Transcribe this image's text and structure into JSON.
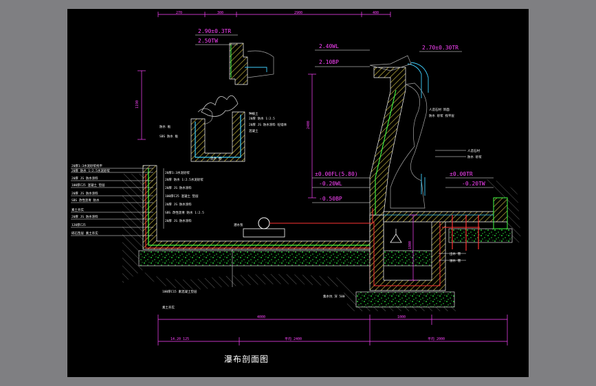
{
  "title": "瀑布剖面图",
  "elevations": {
    "top_left_tr": "2.90±0.3TR",
    "top_left_tw": "2.50TW",
    "mid_wl": "2.40WL",
    "mid_bp": "2.10BP",
    "top_right_tr": "2.70±0.30TR",
    "fl": "±0.00FL(5.80)",
    "low_wl": "-0.20WL",
    "low_bp": "-0.50BP",
    "right_tr": "±0.00TR",
    "right_tw": "-0.20TW"
  },
  "top_dims": [
    "270",
    "300",
    "2900",
    "400"
  ],
  "bottom_dims": [
    "4000",
    "1000"
  ],
  "bottom_total_dims": [
    "14.20 125",
    "平均 2400",
    "平均 2000"
  ],
  "left_dim_vertical": "1190",
  "mid_dim_vertical": "2400",
  "right_dim_vertical": "1800",
  "layer_notes_left": [
    "20厚1:3水泥砂浆找平",
    "20厚 防水 1:2.5水泥砂浆",
    "20厚 JS 防水涂料",
    "100厚C25 混凝土 垫层",
    "20厚 JS 防水涂料",
    "SBS 改性沥青 防水",
    "素土夯实",
    "20厚 JS 防水涂料",
    "120厚C25",
    "碎石垫层 素土夯实"
  ],
  "layer_notes_mid": [
    "20厚1:3水泥砂浆",
    "20厚 防水 1:2.5水泥砂浆",
    "20厚 JS 防水涂料",
    "100厚C25 混凝土 垫层",
    "20厚 JS 防水涂料",
    "SBS 改性沥青 防水 1:2.5",
    "20厚 JS 防水涂料"
  ],
  "layer_notes_bottom": [
    "100厚C15 素混凝土垫层",
    "素土夯实"
  ],
  "planter_notes": [
    "种植土",
    "20厚 防水 1:2.5",
    "20厚 JS 防水涂料 砼墙体",
    "混凝土"
  ],
  "planter_left_notes": [
    "防水 板",
    "SBS 防水 板"
  ],
  "planter_bottom_note": "滤水 板",
  "pump_label": "潜水泵",
  "right_notes": [
    "人造石材 饰面",
    "防水 砂浆 找平层"
  ],
  "right_top_notes": [
    "人造石材",
    "防水 砂浆"
  ],
  "pit_note": "集水坑 深 500",
  "right_pipe_note": "出水 管",
  "right_pipe_note2": "溢水 管"
}
